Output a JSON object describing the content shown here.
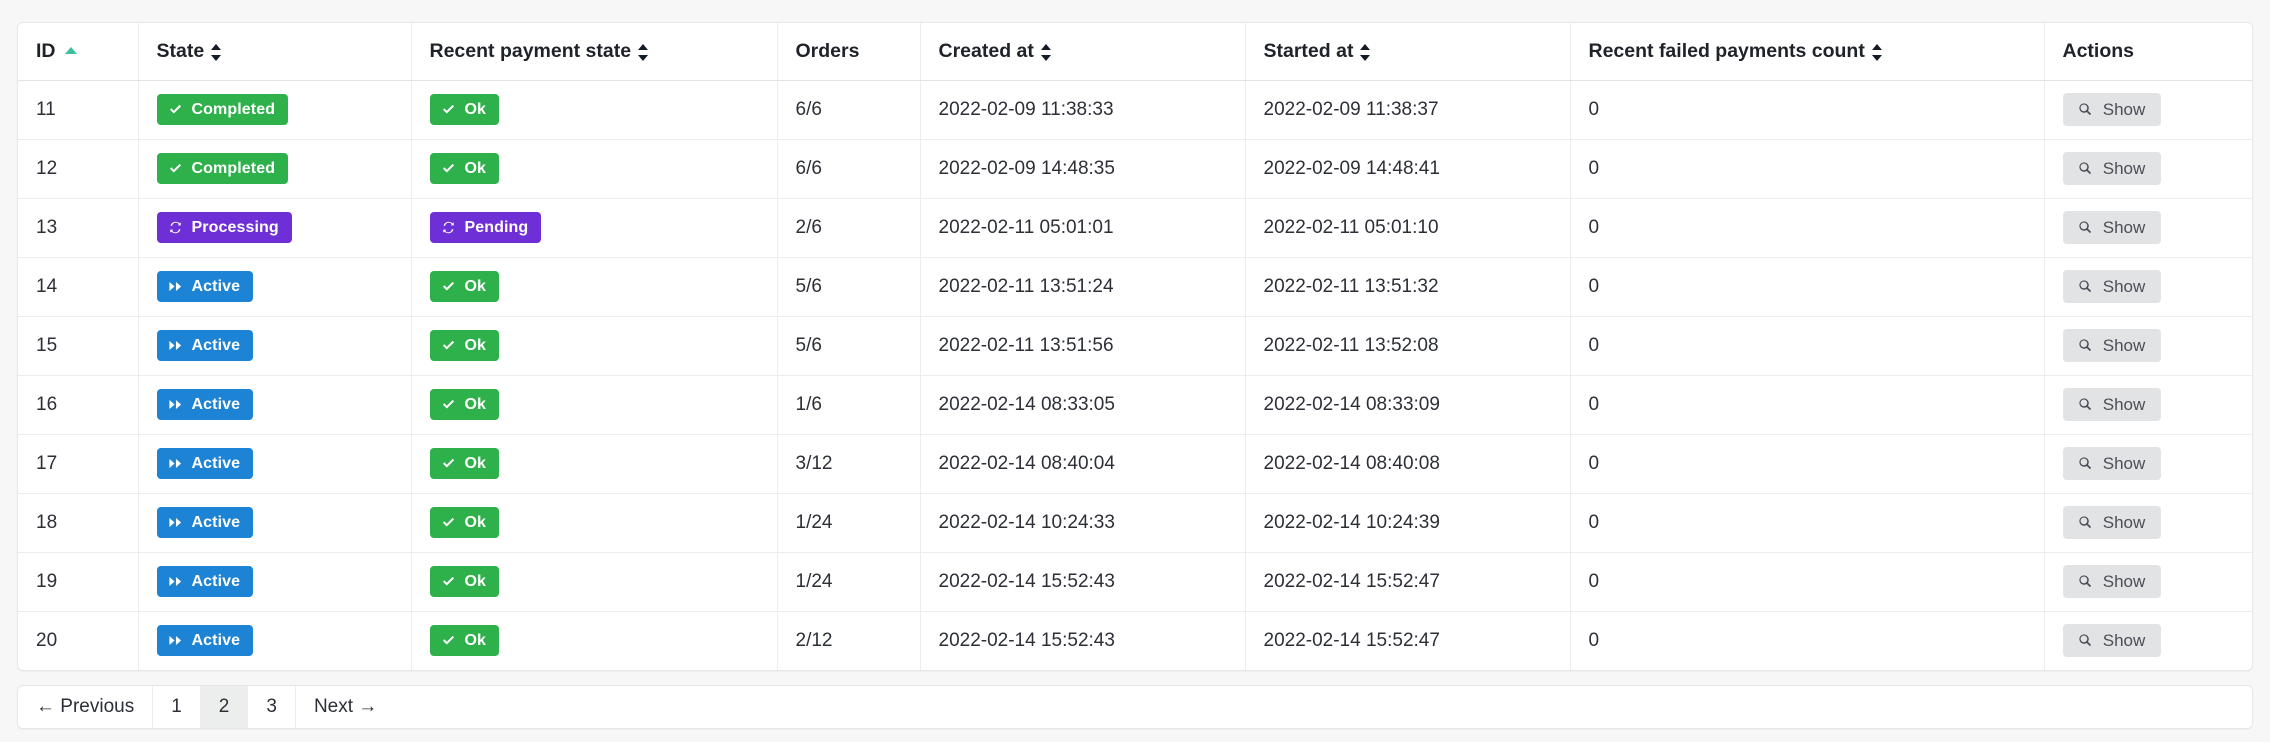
{
  "table": {
    "columns": [
      {
        "label": "ID",
        "sort": "asc"
      },
      {
        "label": "State",
        "sort": "both"
      },
      {
        "label": "Recent payment state",
        "sort": "both"
      },
      {
        "label": "Orders",
        "sort": "none"
      },
      {
        "label": "Created at",
        "sort": "both"
      },
      {
        "label": "Started at",
        "sort": "both"
      },
      {
        "label": "Recent failed payments count",
        "sort": "both"
      },
      {
        "label": "Actions",
        "sort": "none"
      }
    ],
    "action_label": "Show",
    "rows": [
      {
        "id": "11",
        "state": "Completed",
        "state_variant": "green",
        "state_icon": "check-icon",
        "payment": "Ok",
        "payment_variant": "green",
        "payment_icon": "check-icon",
        "orders": "6/6",
        "created_at": "2022-02-09 11:38:33",
        "started_at": "2022-02-09 11:38:37",
        "failed": "0"
      },
      {
        "id": "12",
        "state": "Completed",
        "state_variant": "green",
        "state_icon": "check-icon",
        "payment": "Ok",
        "payment_variant": "green",
        "payment_icon": "check-icon",
        "orders": "6/6",
        "created_at": "2022-02-09 14:48:35",
        "started_at": "2022-02-09 14:48:41",
        "failed": "0"
      },
      {
        "id": "13",
        "state": "Processing",
        "state_variant": "purple",
        "state_icon": "sync-icon",
        "payment": "Pending",
        "payment_variant": "purple",
        "payment_icon": "sync-icon",
        "orders": "2/6",
        "created_at": "2022-02-11 05:01:01",
        "started_at": "2022-02-11 05:01:10",
        "failed": "0"
      },
      {
        "id": "14",
        "state": "Active",
        "state_variant": "blue",
        "state_icon": "fast-forward-icon",
        "payment": "Ok",
        "payment_variant": "green",
        "payment_icon": "check-icon",
        "orders": "5/6",
        "created_at": "2022-02-11 13:51:24",
        "started_at": "2022-02-11 13:51:32",
        "failed": "0"
      },
      {
        "id": "15",
        "state": "Active",
        "state_variant": "blue",
        "state_icon": "fast-forward-icon",
        "payment": "Ok",
        "payment_variant": "green",
        "payment_icon": "check-icon",
        "orders": "5/6",
        "created_at": "2022-02-11 13:51:56",
        "started_at": "2022-02-11 13:52:08",
        "failed": "0"
      },
      {
        "id": "16",
        "state": "Active",
        "state_variant": "blue",
        "state_icon": "fast-forward-icon",
        "payment": "Ok",
        "payment_variant": "green",
        "payment_icon": "check-icon",
        "orders": "1/6",
        "created_at": "2022-02-14 08:33:05",
        "started_at": "2022-02-14 08:33:09",
        "failed": "0"
      },
      {
        "id": "17",
        "state": "Active",
        "state_variant": "blue",
        "state_icon": "fast-forward-icon",
        "payment": "Ok",
        "payment_variant": "green",
        "payment_icon": "check-icon",
        "orders": "3/12",
        "created_at": "2022-02-14 08:40:04",
        "started_at": "2022-02-14 08:40:08",
        "failed": "0"
      },
      {
        "id": "18",
        "state": "Active",
        "state_variant": "blue",
        "state_icon": "fast-forward-icon",
        "payment": "Ok",
        "payment_variant": "green",
        "payment_icon": "check-icon",
        "orders": "1/24",
        "created_at": "2022-02-14 10:24:33",
        "started_at": "2022-02-14 10:24:39",
        "failed": "0"
      },
      {
        "id": "19",
        "state": "Active",
        "state_variant": "blue",
        "state_icon": "fast-forward-icon",
        "payment": "Ok",
        "payment_variant": "green",
        "payment_icon": "check-icon",
        "orders": "1/24",
        "created_at": "2022-02-14 15:52:43",
        "started_at": "2022-02-14 15:52:47",
        "failed": "0"
      },
      {
        "id": "20",
        "state": "Active",
        "state_variant": "blue",
        "state_icon": "fast-forward-icon",
        "payment": "Ok",
        "payment_variant": "green",
        "payment_icon": "check-icon",
        "orders": "2/12",
        "created_at": "2022-02-14 15:52:43",
        "started_at": "2022-02-14 15:52:47",
        "failed": "0"
      }
    ]
  },
  "pagination": {
    "items": [
      {
        "label": "← Previous",
        "active": false
      },
      {
        "label": "1",
        "active": false
      },
      {
        "label": "2",
        "active": true
      },
      {
        "label": "3",
        "active": false
      },
      {
        "label": "Next →",
        "active": false
      }
    ]
  },
  "colors": {
    "green": "#2eb14b",
    "purple": "#6f2fd6",
    "blue": "#1d83d4",
    "sort_active": "#3bbfa0",
    "page_bg": "#f7f7f8",
    "button_bg": "#e2e3e5"
  }
}
